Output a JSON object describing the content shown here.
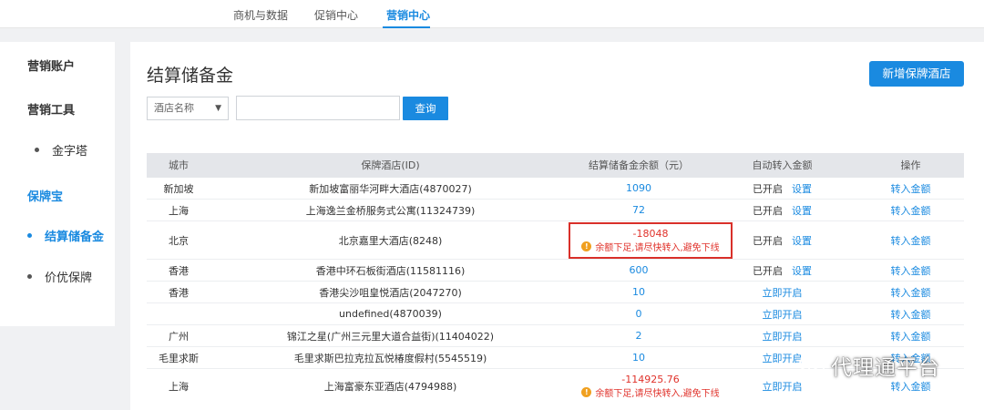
{
  "topnav": {
    "items": [
      {
        "label": "商机与数据"
      },
      {
        "label": "促销中心"
      },
      {
        "label": "营销中心"
      }
    ]
  },
  "sidebar": {
    "section1": "营销账户",
    "section2": "营销工具",
    "tool_items": [
      "金字塔"
    ],
    "section3": "保牌宝",
    "bao_items": [
      "结算储备金",
      "价优保牌"
    ]
  },
  "main": {
    "title": "结算储备金",
    "add_button": "新增保牌酒店",
    "filter_select": "酒店名称",
    "search_value": "",
    "query_button": "查询"
  },
  "table": {
    "headers": [
      "城市",
      "保牌酒店(ID)",
      "结算储备金余额（元）",
      "自动转入金额",
      "操作"
    ],
    "rows": [
      {
        "city": "新加坡",
        "hotel": "新加坡富丽华河畔大酒店(4870027)",
        "balance": "1090",
        "auto_status": "已开启",
        "auto_action": "设置",
        "op": "转入金额"
      },
      {
        "city": "上海",
        "hotel": "上海逸兰金桥服务式公寓(11324739)",
        "balance": "72",
        "auto_status": "已开启",
        "auto_action": "设置",
        "op": "转入金额"
      },
      {
        "city": "北京",
        "hotel": "北京嘉里大酒店(8248)",
        "balance": "-18048",
        "warning": "余额下足,请尽快转入,避免下线",
        "auto_status": "已开启",
        "auto_action": "设置",
        "op": "转入金额"
      },
      {
        "city": "香港",
        "hotel": "香港中环石板街酒店(11581116)",
        "balance": "600",
        "auto_status": "已开启",
        "auto_action": "设置",
        "op": "转入金额"
      },
      {
        "city": "香港",
        "hotel": "香港尖沙咀皇悦酒店(2047270)",
        "balance": "10",
        "auto_action": "立即开启",
        "op": "转入金额"
      },
      {
        "city": "",
        "hotel": "undefined(4870039)",
        "balance": "0",
        "auto_action": "立即开启",
        "op": "转入金额"
      },
      {
        "city": "广州",
        "hotel": "锦江之星(广州三元里大道合益街)(11404022)",
        "balance": "2",
        "auto_action": "立即开启",
        "op": "转入金额"
      },
      {
        "city": "毛里求斯",
        "hotel": "毛里求斯巴拉克拉瓦悦椿度假村(5545519)",
        "balance": "10",
        "auto_action": "立即开启",
        "op": "转入金额"
      },
      {
        "city": "上海",
        "hotel": "上海富豪东亚酒店(4794988)",
        "balance": "-114925.76",
        "warning": "余额下足,请尽快转入,避免下线",
        "auto_action": "立即开启",
        "op": "转入金额"
      }
    ]
  },
  "watermark": {
    "text": "代理通平台"
  }
}
